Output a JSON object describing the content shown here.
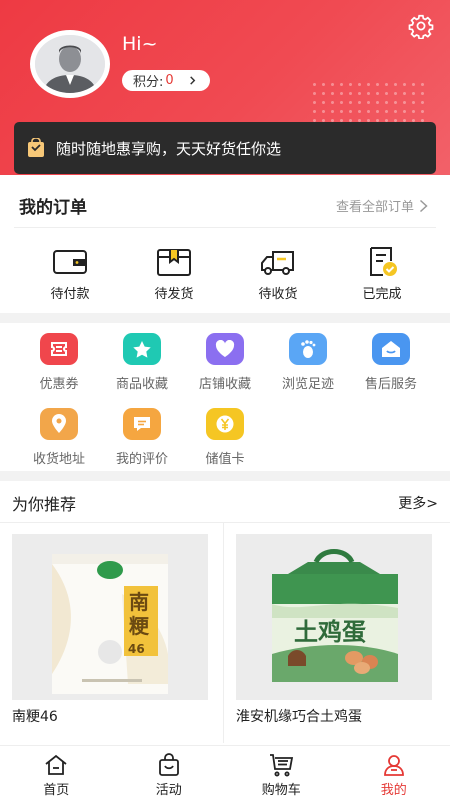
{
  "header": {
    "greeting": "Hi~",
    "points_label": "积分:",
    "points_value": "0",
    "accent_color": "#ee3a43"
  },
  "banner": {
    "text": "随时随地惠享购，天天好货任你选"
  },
  "orders": {
    "title": "我的订单",
    "view_all": "查看全部订单",
    "items": [
      {
        "label": "待付款",
        "icon": "wallet-icon"
      },
      {
        "label": "待发货",
        "icon": "package-icon"
      },
      {
        "label": "待收货",
        "icon": "truck-icon"
      },
      {
        "label": "已完成",
        "icon": "completed-doc-icon"
      }
    ]
  },
  "services": {
    "items": [
      {
        "label": "优惠券",
        "icon": "coupon-icon",
        "color": "#f0464c"
      },
      {
        "label": "商品收藏",
        "icon": "star-icon",
        "color": "#1fc9b3"
      },
      {
        "label": "店铺收藏",
        "icon": "heart-icon",
        "color": "#8b6ff0"
      },
      {
        "label": "浏览足迹",
        "icon": "footprint-icon",
        "color": "#5aa6f5"
      },
      {
        "label": "售后服务",
        "icon": "home-service-icon",
        "color": "#4a96f0"
      },
      {
        "label": "收货地址",
        "icon": "location-icon",
        "color": "#f2a64a"
      },
      {
        "label": "我的评价",
        "icon": "comment-icon",
        "color": "#f5a640"
      },
      {
        "label": "储值卡",
        "icon": "yen-icon",
        "color": "#f5c623"
      }
    ]
  },
  "recommend": {
    "title": "为你推荐",
    "more": "更多>",
    "products": [
      {
        "name": "南粳46",
        "package_text": "南粳",
        "package_number": "46"
      },
      {
        "name": "淮安机缘巧合土鸡蛋",
        "package_text": "土鸡蛋"
      }
    ]
  },
  "tabbar": {
    "items": [
      {
        "label": "首页",
        "icon": "home-icon"
      },
      {
        "label": "活动",
        "icon": "shopping-bag-icon"
      },
      {
        "label": "购物车",
        "icon": "cart-icon"
      },
      {
        "label": "我的",
        "icon": "profile-icon",
        "active": true
      }
    ]
  }
}
